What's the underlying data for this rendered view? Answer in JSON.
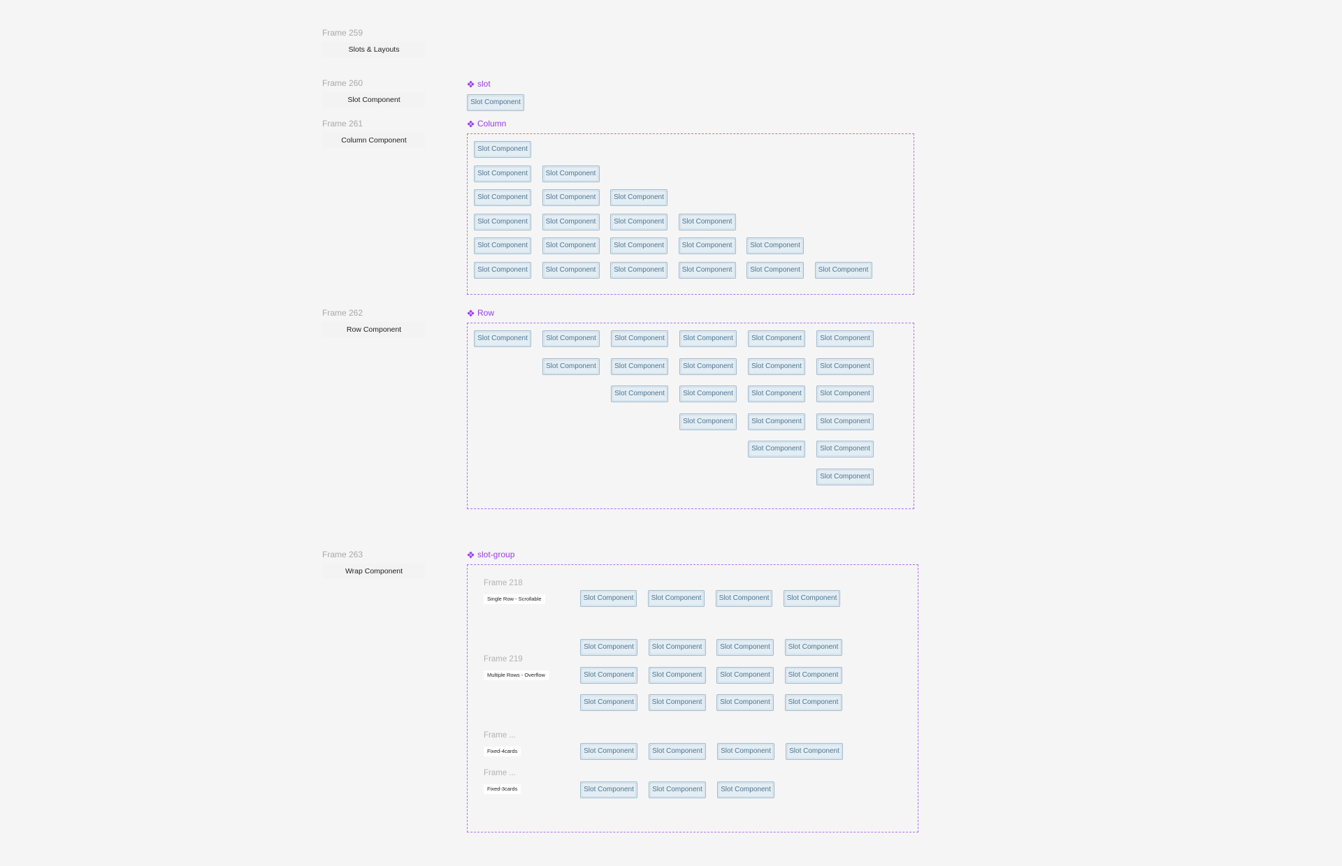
{
  "frames": {
    "f259": {
      "label": "Frame 259",
      "title": "Slots & Layouts"
    },
    "f260": {
      "label": "Frame 260",
      "title": "Slot Component"
    },
    "f261": {
      "label": "Frame 261",
      "title": "Column Component"
    },
    "f262": {
      "label": "Frame 262",
      "title": "Row Component"
    },
    "f263": {
      "label": "Frame 263",
      "title": "Wrap Component"
    }
  },
  "components": {
    "slot": {
      "title": "slot",
      "icon": "component-icon"
    },
    "column": {
      "title": "Column",
      "icon": "component-icon"
    },
    "row": {
      "title": "Row",
      "icon": "component-icon"
    },
    "slot_group": {
      "title": "slot-group",
      "icon": "component-icon"
    }
  },
  "slot_label": "Slot Component",
  "wrap_sub": {
    "f218": {
      "label": "Frame 218",
      "title": "Single Row - Scrollable"
    },
    "f219": {
      "label": "Frame 219",
      "title": "Multiple Rows - Overflow"
    },
    "fa": {
      "label": "Frame ...",
      "title": "Fixed-4cards"
    },
    "fb": {
      "label": "Frame ...",
      "title": "Fixed-3cards"
    }
  },
  "colors": {
    "background": "#f5f5f5",
    "component_accent": "#9b3ce8",
    "dashed_border": "#b06ff0",
    "slot_fill": "#e3edf4",
    "slot_border": "#9fb9cc",
    "slot_text": "#4f7590"
  }
}
